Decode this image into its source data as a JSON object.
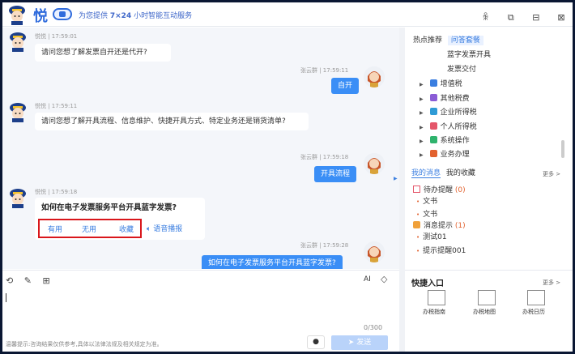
{
  "header": {
    "brand": "悦",
    "slogan_prefix": "为您提供 ",
    "slogan_bold": "7×24",
    "slogan_suffix": " 小时智能互动服务"
  },
  "messages": [
    {
      "role": "bot",
      "meta": "悦悦 | 17:59:01",
      "text": "请问您想了解发票自开还是代开?"
    },
    {
      "role": "user",
      "meta": "张云群 | 17:59:11",
      "text": "自开"
    },
    {
      "role": "bot",
      "meta": "悦悦 | 17:59:11",
      "text": "请问您想了解开具流程、信息维护、快捷开具方式、特定业务还是销货清单?"
    },
    {
      "role": "user",
      "meta": "张云群 | 17:59:18",
      "text": "开具流程"
    },
    {
      "role": "bot",
      "meta": "悦悦 | 17:59:18",
      "title": "如何在电子发票服务平台开具蓝字发票?"
    },
    {
      "role": "user",
      "meta": "张云群 | 17:59:28",
      "text": "如何在电子发票服务平台开具蓝字发票?"
    }
  ],
  "feedback": {
    "useful": "有用",
    "useless": "无用",
    "collect": "收藏",
    "voice": "语音播报"
  },
  "right": {
    "tab_hot": "热点推荐",
    "tab_qa": "问答套餐",
    "sub_items": [
      "蓝字发票开具",
      "发票交付"
    ],
    "categories": [
      {
        "label": "增值税",
        "color": "#3a7ee0"
      },
      {
        "label": "其他税费",
        "color": "#8a5cd6"
      },
      {
        "label": "企业所得税",
        "color": "#2f9bd6"
      },
      {
        "label": "个人所得税",
        "color": "#e4566a"
      },
      {
        "label": "系统操作",
        "color": "#2fb36d"
      },
      {
        "label": "业务办理",
        "color": "#e2622f"
      }
    ],
    "tab_msg": "我的消息",
    "tab_fav": "我的收藏",
    "more": "更多 >",
    "todo_label": "待办提醒 ",
    "todo_count": "(0)",
    "doc1": "文书",
    "doc2": "文书",
    "notice_label": "消息提示 ",
    "notice_count": "(1)",
    "test1": "测试01",
    "test2": "提示提醒001"
  },
  "input": {
    "ai": "AI",
    "counter": "0/300",
    "hint": "温馨提示:咨询结果仅供参考,具体以法律法规及相关规定为准。",
    "send": "发送"
  },
  "shortcut": {
    "title": "快捷入口",
    "more": "更多 >",
    "items": [
      "办税指南",
      "办税地图",
      "办税日历"
    ]
  }
}
